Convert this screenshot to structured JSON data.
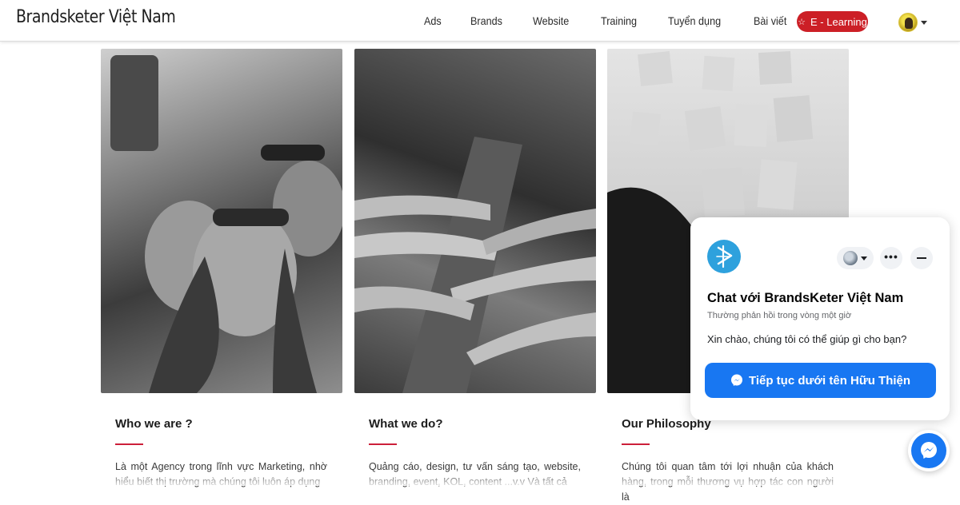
{
  "header": {
    "brand": "Brandsketer Việt Nam",
    "nav": [
      {
        "label": "Ads"
      },
      {
        "label": "Brands"
      },
      {
        "label": "Website"
      },
      {
        "label": "Training"
      },
      {
        "label": "Tuyển dụng"
      },
      {
        "label": "Bài viết"
      }
    ],
    "elearning_label": "E - Learning",
    "elearning_icon": "star-icon",
    "accent_color": "#cc1f26"
  },
  "photos": [
    {
      "alt": "group-selfie-photo"
    },
    {
      "alt": "hands-on-tree-photo"
    },
    {
      "alt": "sticky-notes-wall-photo"
    }
  ],
  "cards": [
    {
      "title": "Who we are ?",
      "text": "Là một Agency trong lĩnh vực Marketing, nhờ hiểu biết thị trường mà chúng tôi luôn áp dụng"
    },
    {
      "title": "What we do?",
      "text": "Quảng cáo, design, tư vấn sáng tạo, website, branding, event, KOL, content ...v.v Và tất cả"
    },
    {
      "title": "Our Philosophy",
      "text": "Chúng tôi quan tâm tới lợi nhuận của khách hàng, trong mỗi thương vụ hợp tác con người là"
    }
  ],
  "chat": {
    "title": "Chat với BrandsKeter Việt Nam",
    "subtitle": "Thường phản hồi trong vòng một giờ",
    "message": "Xin chào, chúng tôi có thể giúp gì cho bạn?",
    "button_label": "Tiếp tục dưới tên Hữu Thiện",
    "more_label": "•••",
    "brand_color": "#1877f2"
  }
}
